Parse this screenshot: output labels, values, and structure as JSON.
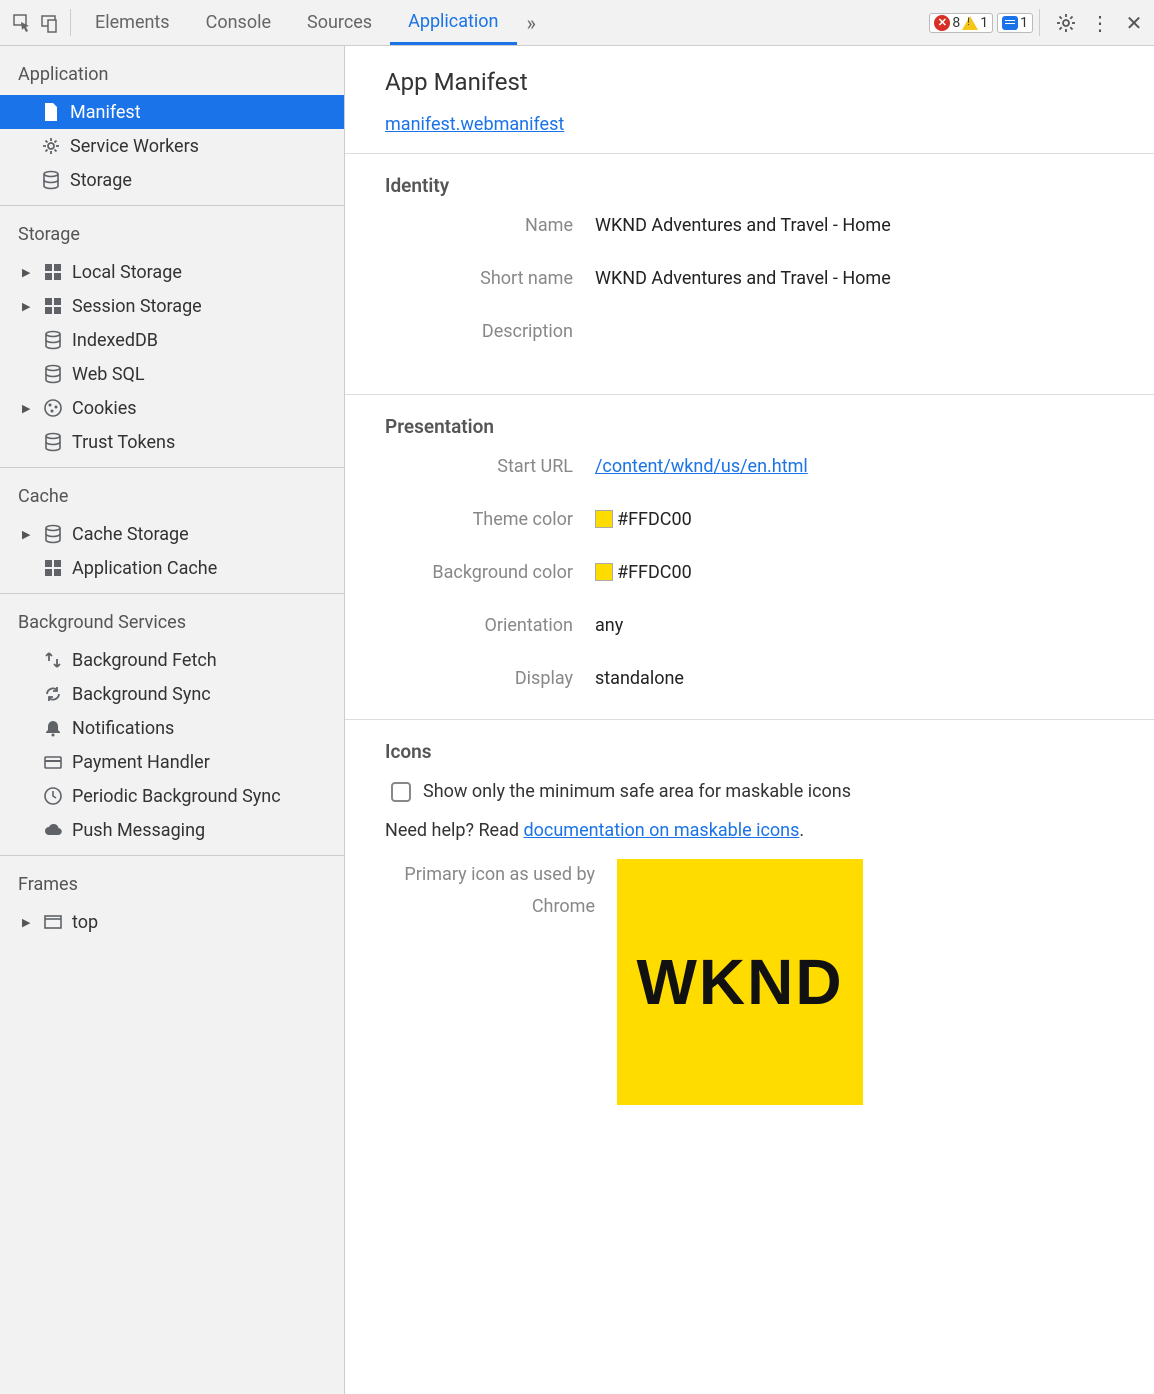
{
  "toolbar": {
    "tabs": [
      "Elements",
      "Console",
      "Sources",
      "Application"
    ],
    "active_tab": 3,
    "errors": 8,
    "warnings": 1,
    "messages": 1
  },
  "sidebar": {
    "sections": [
      {
        "title": "Application",
        "items": [
          {
            "label": "Manifest",
            "icon": "file",
            "selected": true
          },
          {
            "label": "Service Workers",
            "icon": "gear"
          },
          {
            "label": "Storage",
            "icon": "db"
          }
        ]
      },
      {
        "title": "Storage",
        "items": [
          {
            "label": "Local Storage",
            "icon": "grid",
            "tri": true
          },
          {
            "label": "Session Storage",
            "icon": "grid",
            "tri": true
          },
          {
            "label": "IndexedDB",
            "icon": "db"
          },
          {
            "label": "Web SQL",
            "icon": "db"
          },
          {
            "label": "Cookies",
            "icon": "cookie",
            "tri": true
          },
          {
            "label": "Trust Tokens",
            "icon": "db"
          }
        ]
      },
      {
        "title": "Cache",
        "items": [
          {
            "label": "Cache Storage",
            "icon": "db",
            "tri": true
          },
          {
            "label": "Application Cache",
            "icon": "grid"
          }
        ]
      },
      {
        "title": "Background Services",
        "items": [
          {
            "label": "Background Fetch",
            "icon": "fetch"
          },
          {
            "label": "Background Sync",
            "icon": "sync"
          },
          {
            "label": "Notifications",
            "icon": "bell"
          },
          {
            "label": "Payment Handler",
            "icon": "card"
          },
          {
            "label": "Periodic Background Sync",
            "icon": "clock"
          },
          {
            "label": "Push Messaging",
            "icon": "cloud"
          }
        ]
      },
      {
        "title": "Frames",
        "items": [
          {
            "label": "top",
            "icon": "frame",
            "tri": true
          }
        ]
      }
    ]
  },
  "manifest": {
    "title": "App Manifest",
    "file": "manifest.webmanifest",
    "identity": {
      "heading": "Identity",
      "name_label": "Name",
      "name": "WKND Adventures and Travel - Home",
      "short_name_label": "Short name",
      "short_name": "WKND Adventures and Travel - Home",
      "description_label": "Description",
      "description": ""
    },
    "presentation": {
      "heading": "Presentation",
      "start_url_label": "Start URL",
      "start_url": "/content/wknd/us/en.html",
      "theme_color_label": "Theme color",
      "theme_color": "#FFDC00",
      "background_color_label": "Background color",
      "background_color": "#FFDC00",
      "orientation_label": "Orientation",
      "orientation": "any",
      "display_label": "Display",
      "display": "standalone"
    },
    "icons": {
      "heading": "Icons",
      "checkbox_label": "Show only the minimum safe area for maskable icons",
      "help_prefix": "Need help? Read ",
      "help_link": "documentation on maskable icons",
      "help_suffix": ".",
      "primary_label": "Primary icon as used by Chrome",
      "icon_text": "WKND"
    }
  }
}
